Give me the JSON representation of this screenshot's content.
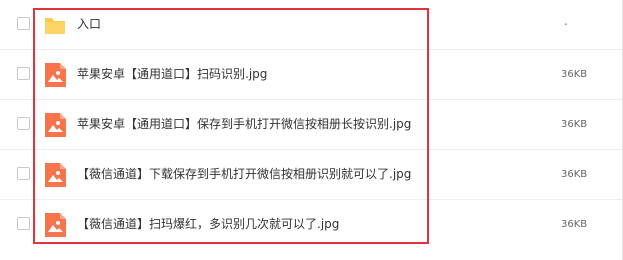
{
  "files": [
    {
      "name": "入口",
      "size": "-",
      "icon": "folder-icon",
      "color": "#FFC84D"
    },
    {
      "name": "苹果安卓【通用道口】扫码识别.jpg",
      "size": "36KB",
      "icon": "image-file-icon",
      "color": "#F8744D"
    },
    {
      "name": "苹果安卓【通用道口】保存到手机打开微信按相册长按识别.jpg",
      "size": "36KB",
      "icon": "image-file-icon",
      "color": "#F8744D"
    },
    {
      "name": "【薇信通道】下载保存到手机打开微信按相册识别就可以了.jpg",
      "size": "36KB",
      "icon": "image-file-icon",
      "color": "#F8744D"
    },
    {
      "name": "【薇信通道】扫玛爆红，多识别几次就可以了.jpg",
      "size": "36KB",
      "icon": "image-file-icon",
      "color": "#F8744D"
    }
  ],
  "highlight_color": "#E0333A"
}
